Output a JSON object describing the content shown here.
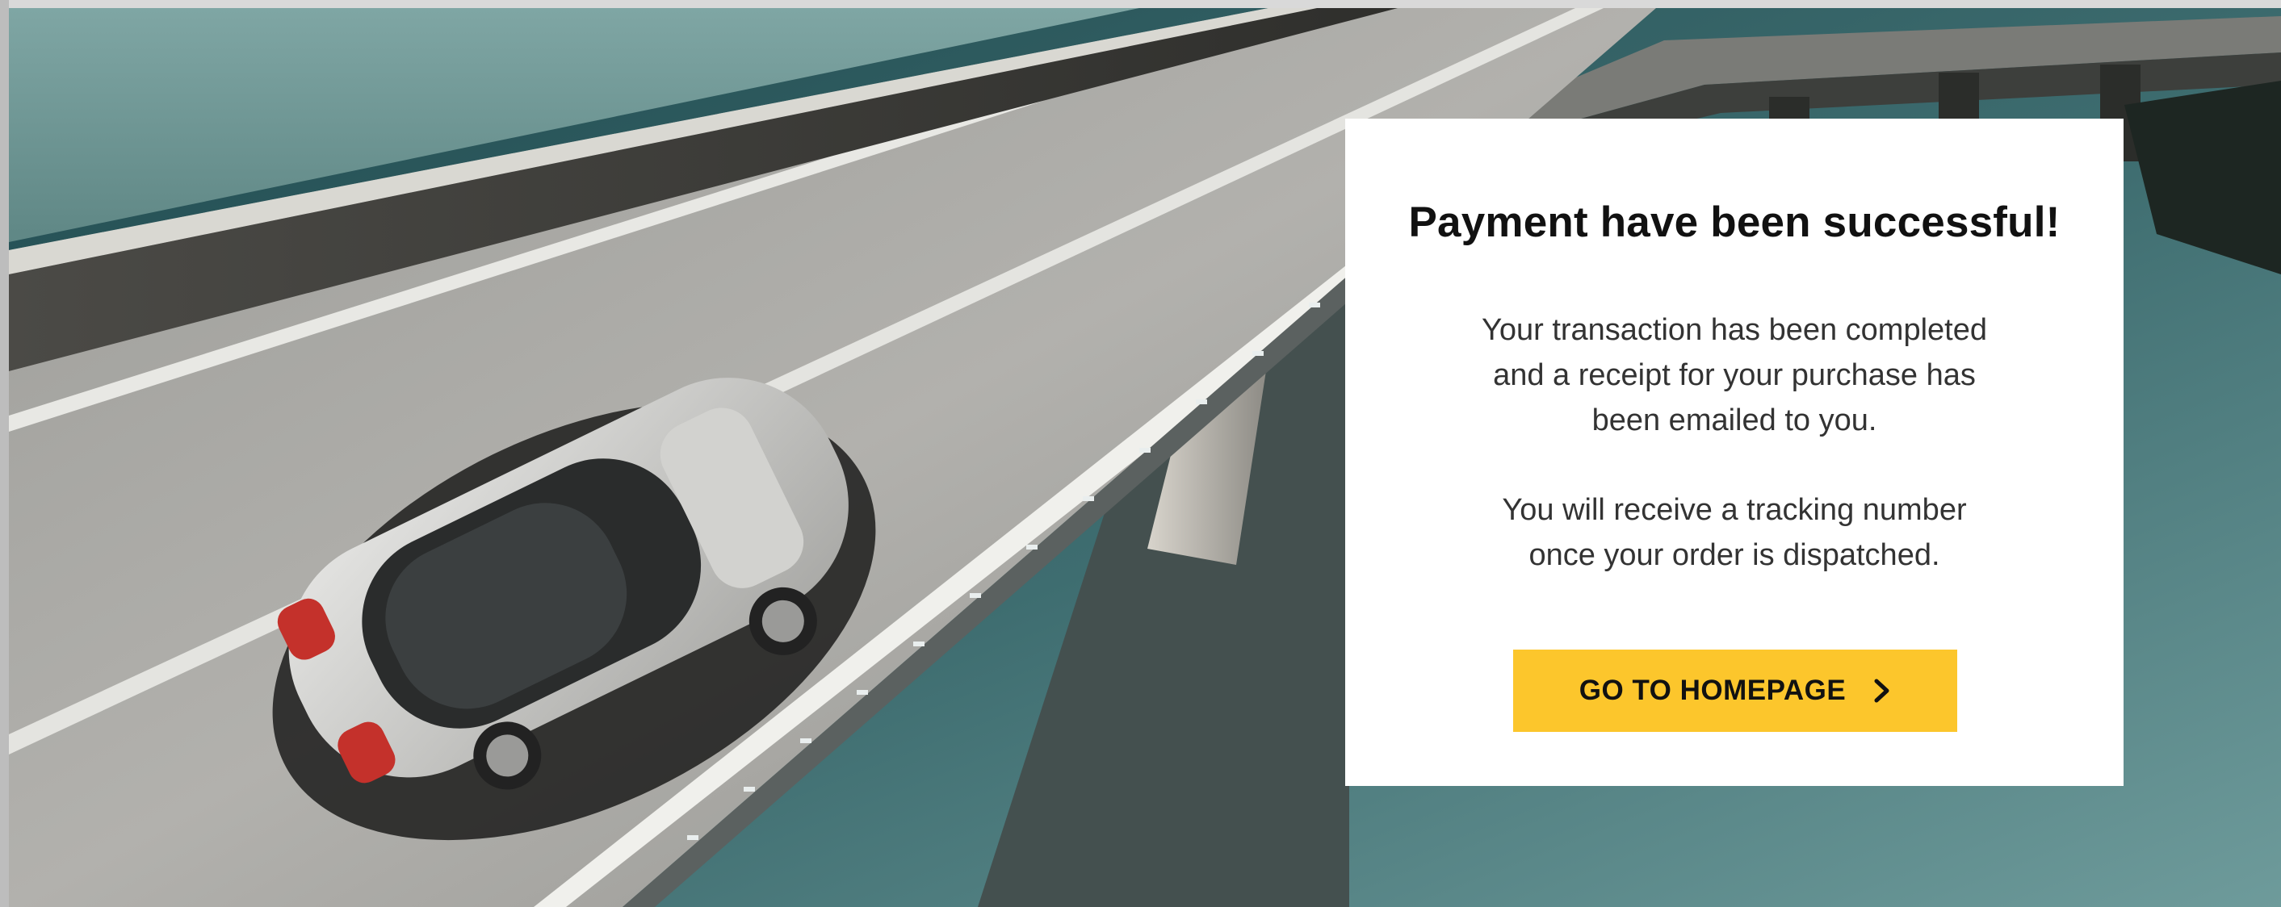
{
  "success_card": {
    "title": "Payment have been successful!",
    "message_1_lines": [
      "Your transaction has been completed",
      "and a receipt for your purchase has",
      "been emailed to you."
    ],
    "message_2_lines": [
      "You will receive a tracking number",
      "once your order is dispatched."
    ],
    "cta_label": "GO TO HOMEPAGE",
    "cta_icon": "chevron-right-icon"
  },
  "colors": {
    "accent": "#fcc62c",
    "card_background": "#ffffff",
    "title_text": "#111111",
    "body_text": "#333333"
  }
}
